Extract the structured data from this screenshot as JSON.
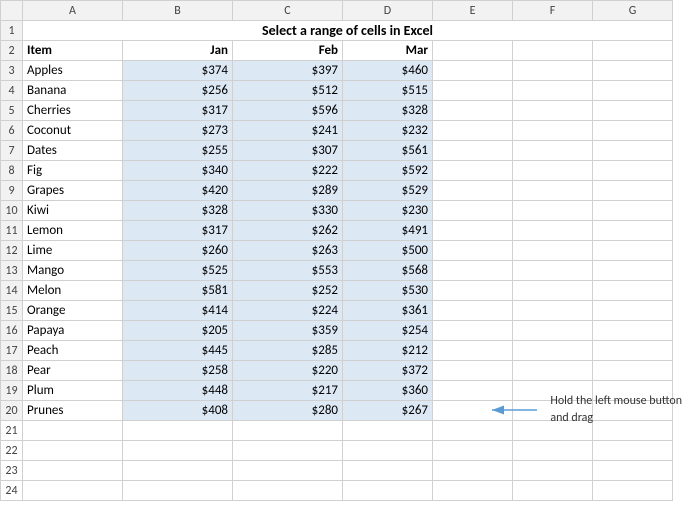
{
  "title": "Select a range of cells in Excel",
  "columns": [
    "",
    "A",
    "B",
    "C",
    "D",
    "E",
    "F",
    "G"
  ],
  "colHeaders": [
    "Item",
    "Jan",
    "Feb",
    "Mar"
  ],
  "rows": [
    {
      "item": "Apples",
      "jan": "$374",
      "feb": "$397",
      "mar": "$460"
    },
    {
      "item": "Banana",
      "jan": "$256",
      "feb": "$512",
      "mar": "$515"
    },
    {
      "item": "Cherries",
      "jan": "$317",
      "feb": "$596",
      "mar": "$328"
    },
    {
      "item": "Coconut",
      "jan": "$273",
      "feb": "$241",
      "mar": "$232"
    },
    {
      "item": "Dates",
      "jan": "$255",
      "feb": "$307",
      "mar": "$561"
    },
    {
      "item": "Fig",
      "jan": "$340",
      "feb": "$222",
      "mar": "$592"
    },
    {
      "item": "Grapes",
      "jan": "$420",
      "feb": "$289",
      "mar": "$529"
    },
    {
      "item": "Kiwi",
      "jan": "$328",
      "feb": "$330",
      "mar": "$230"
    },
    {
      "item": "Lemon",
      "jan": "$317",
      "feb": "$262",
      "mar": "$491"
    },
    {
      "item": "Lime",
      "jan": "$260",
      "feb": "$263",
      "mar": "$500"
    },
    {
      "item": "Mango",
      "jan": "$525",
      "feb": "$553",
      "mar": "$568"
    },
    {
      "item": "Melon",
      "jan": "$581",
      "feb": "$252",
      "mar": "$530"
    },
    {
      "item": "Orange",
      "jan": "$414",
      "feb": "$224",
      "mar": "$361"
    },
    {
      "item": "Papaya",
      "jan": "$205",
      "feb": "$359",
      "mar": "$254"
    },
    {
      "item": "Peach",
      "jan": "$445",
      "feb": "$285",
      "mar": "$212"
    },
    {
      "item": "Pear",
      "jan": "$258",
      "feb": "$220",
      "mar": "$372"
    },
    {
      "item": "Plum",
      "jan": "$448",
      "feb": "$217",
      "mar": "$360"
    },
    {
      "item": "Prunes",
      "jan": "$408",
      "feb": "$280",
      "mar": "$267"
    }
  ],
  "annotation": {
    "text": "Hold the left mouse button\nand drag",
    "arrow_label": "arrow"
  }
}
